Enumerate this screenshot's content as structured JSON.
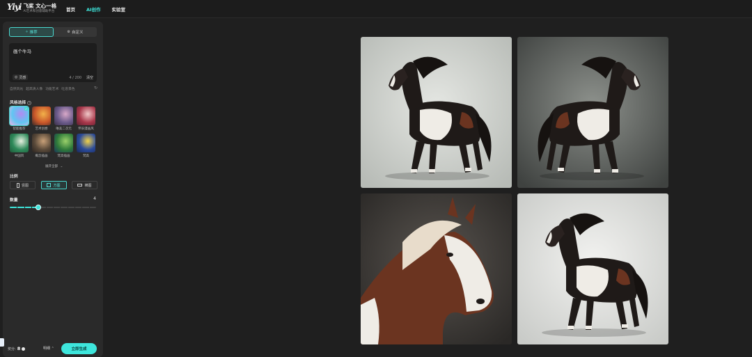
{
  "app": {
    "logo_mark": "Yiyi",
    "logo_title": "飞桨 文心一格",
    "logo_subtitle": "AI艺术和创意辅助平台"
  },
  "nav": [
    {
      "label": "首页",
      "active": false
    },
    {
      "label": "AI创作",
      "active": true
    },
    {
      "label": "实验室",
      "active": false
    }
  ],
  "mode_tabs": [
    {
      "label": "推荐",
      "icon": "sparkle-icon",
      "active": true
    },
    {
      "label": "自定义",
      "icon": "settings-icon",
      "active": false
    }
  ],
  "prompt": {
    "value": "画个牛马",
    "inspire_label": "灵感",
    "counter": "4 / 200",
    "clear_label": "清空"
  },
  "suggestion_tags": [
    "自然风光",
    "超高清人像",
    "功能艺术",
    "吐息景色"
  ],
  "style_section": {
    "label": "风格选择",
    "items": [
      {
        "label": "智能推荐",
        "selected": true,
        "colors": [
          "#60c6f2",
          "#b18cf2",
          "#f0b4e6"
        ]
      },
      {
        "label": "艺术创想",
        "selected": false,
        "colors": [
          "#c9572a",
          "#f2b24a",
          "#3a2a28"
        ]
      },
      {
        "label": "唯美二次元",
        "selected": false,
        "colors": [
          "#6a5a8a",
          "#d8a8c8",
          "#3a3048"
        ]
      },
      {
        "label": "怀旧漫画风",
        "selected": false,
        "colors": [
          "#a8374a",
          "#f0c8c8",
          "#5a2030"
        ]
      },
      {
        "label": "中国风",
        "selected": false,
        "colors": [
          "#2f8a5a",
          "#e8f0e0",
          "#1d5a3a"
        ]
      },
      {
        "label": "概念插画",
        "selected": false,
        "colors": [
          "#5a4a3a",
          "#c8a078",
          "#2a2420"
        ]
      },
      {
        "label": "梵高插画",
        "selected": false,
        "colors": [
          "#2f7a3a",
          "#9ad06a",
          "#1a3a5a"
        ]
      },
      {
        "label": "梵高",
        "selected": false,
        "colors": [
          "#2a4a9a",
          "#f2d24a",
          "#1a2a5a"
        ]
      }
    ],
    "expand_label": "展开全部"
  },
  "ratio_section": {
    "label": "比例",
    "options": [
      {
        "label": "竖图",
        "shape": "portrait",
        "active": false
      },
      {
        "label": "方图",
        "shape": "square",
        "active": true
      },
      {
        "label": "横图",
        "shape": "landscape",
        "active": false
      }
    ]
  },
  "quantity_section": {
    "label": "数量",
    "value": "4",
    "slider_fraction": 0.33
  },
  "footer": {
    "credit_label": "奖分:",
    "credit_value": "8",
    "detail_label": "明细",
    "generate_label": "立即生成"
  },
  "accent_color": "#3ee6dc",
  "gallery": {
    "images": [
      {
        "name": "horse-image-1",
        "bg": [
          "#e4e6e2",
          "#b7bbb6"
        ],
        "pose": "trotting-left"
      },
      {
        "name": "horse-image-2",
        "bg": [
          "#8d918c",
          "#3f4240"
        ],
        "pose": "standing-right"
      },
      {
        "name": "horse-image-3",
        "bg": [
          "#5a5550",
          "#2a2826"
        ],
        "pose": "portrait"
      },
      {
        "name": "horse-image-4",
        "bg": [
          "#f2f2f0",
          "#c9cbc8"
        ],
        "pose": "standing-left"
      }
    ]
  }
}
